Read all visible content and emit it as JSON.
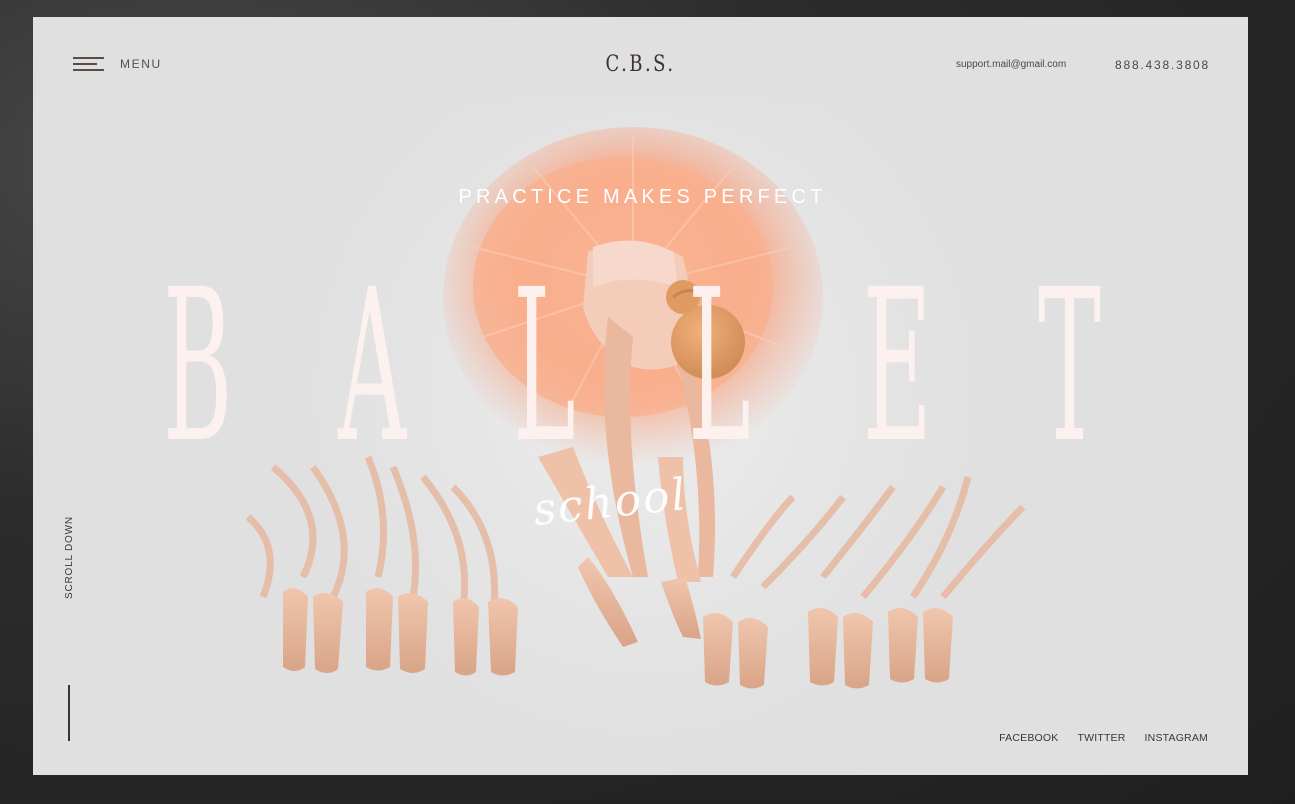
{
  "header": {
    "menu_label": "MENU",
    "logo": "C.B.S.",
    "email": "support.mail@gmail.com",
    "phone": "888.438.3808"
  },
  "hero": {
    "tagline": "PRACTICE MAKES PERFECT",
    "title_letters": [
      "B",
      "A",
      "L",
      "L",
      "E",
      "T"
    ],
    "script_word": "school"
  },
  "side": {
    "scroll_label": "SCROLL DOWN"
  },
  "social": {
    "facebook": "FACEBOOK",
    "twitter": "TWITTER",
    "instagram": "INSTAGRAM"
  },
  "colors": {
    "page_bg": "#e1e0e1",
    "tutu": "#f7a582",
    "shoes": "#e8b59a",
    "title": "#fdf1ef",
    "text_dark": "#3d3330"
  }
}
